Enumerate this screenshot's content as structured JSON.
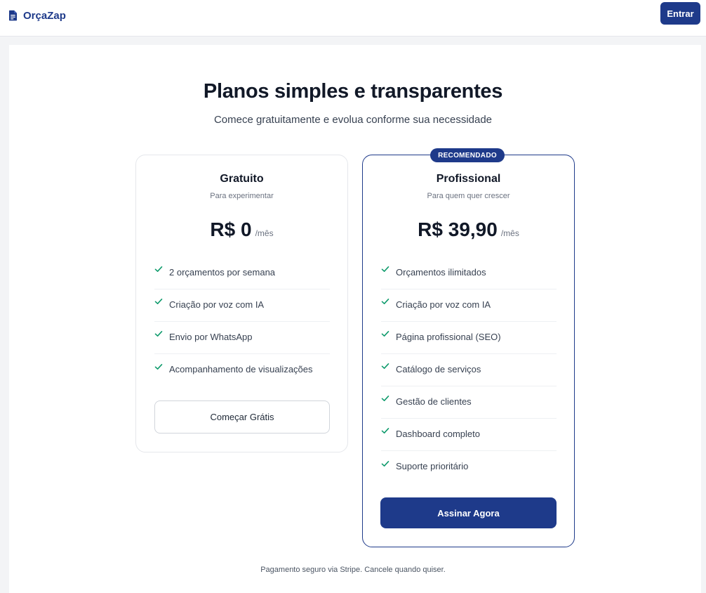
{
  "header": {
    "brand_name": "OrçaZap",
    "brand_icon": "document-icon",
    "login_label": "Entrar"
  },
  "main": {
    "title": "Planos simples e transparentes",
    "subtitle": "Comece gratuitamente e evolua conforme sua necessidade"
  },
  "plans": [
    {
      "name": "Gratuito",
      "description": "Para experimentar",
      "price": "R$ 0",
      "period": "/mês",
      "features": [
        "2 orçamentos por semana",
        "Criação por voz com IA",
        "Envio por WhatsApp",
        "Acompanhamento de visualizações"
      ],
      "cta": "Começar Grátis"
    },
    {
      "badge": "RECOMENDADO",
      "name": "Profissional",
      "description": "Para quem quer crescer",
      "price": "R$ 39,90",
      "period": "/mês",
      "features": [
        "Orçamentos ilimitados",
        "Criação por voz com IA",
        "Página profissional (SEO)",
        "Catálogo de serviços",
        "Gestão de clientes",
        "Dashboard completo",
        "Suporte prioritário"
      ],
      "cta": "Assinar Agora"
    }
  ],
  "footer": {
    "note": "Pagamento seguro via Stripe. Cancele quando quiser."
  },
  "colors": {
    "brand": "#1e3a8a",
    "check": "#0f9b6c",
    "border": "#e5e7eb"
  }
}
